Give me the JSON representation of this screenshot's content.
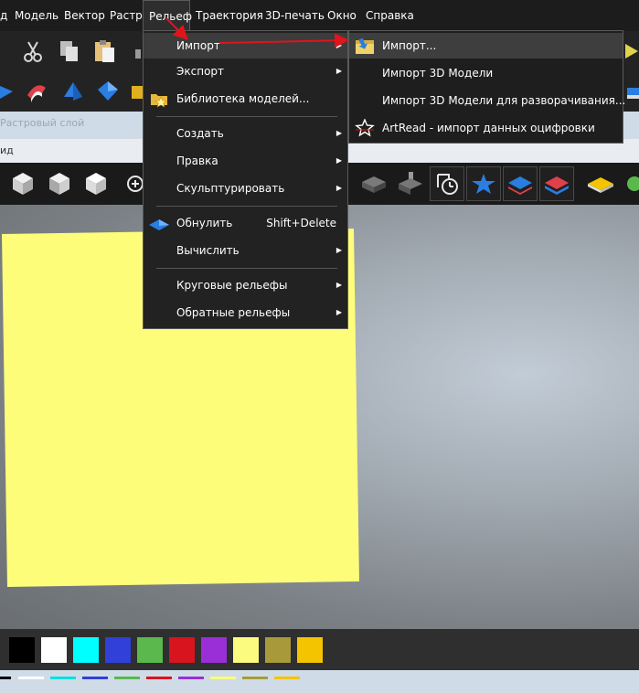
{
  "menubar": {
    "items": [
      {
        "label": "д"
      },
      {
        "label": "Модель"
      },
      {
        "label": "Вектор"
      },
      {
        "label": "Растр"
      },
      {
        "label": "Рельеф"
      },
      {
        "label": "Траектория"
      },
      {
        "label": "3D-печать"
      },
      {
        "label": "Окно"
      },
      {
        "label": "Справка"
      }
    ]
  },
  "panels": {
    "raster_layer": "Растровый слой",
    "view_fragment": "ид"
  },
  "relief_menu": {
    "items": [
      {
        "label": "Импорт",
        "has_submenu": true
      },
      {
        "label": "Экспорт",
        "has_submenu": true
      },
      {
        "label": "Библиотека моделей...",
        "icon": "folder-star-icon"
      },
      {
        "label": "Создать",
        "has_submenu": true
      },
      {
        "label": "Правка",
        "has_submenu": true
      },
      {
        "label": "Скульптурировать",
        "has_submenu": true
      },
      {
        "label": "Обнулить",
        "shortcut": "Shift+Delete",
        "icon": "zero-relief-icon"
      },
      {
        "label": "Вычислить",
        "has_submenu": true
      },
      {
        "label": "Круговые рельефы",
        "has_submenu": true
      },
      {
        "label": "Обратные рельефы",
        "has_submenu": true
      }
    ]
  },
  "import_submenu": {
    "items": [
      {
        "label": "Импорт...",
        "icon": "import-icon"
      },
      {
        "label": "Импорт 3D Модели"
      },
      {
        "label": "Импорт 3D Модели для разворачивания..."
      },
      {
        "label": "ArtRead - импорт данных оцифровки",
        "icon": "artread-star-icon"
      }
    ]
  },
  "colors": {
    "accent_arrow": "#e0141b",
    "relief_preview": "#fdfd7a",
    "palette": [
      "#000000",
      "#ffffff",
      "#00ffff",
      "#3040d8",
      "#5ab84c",
      "#d8141e",
      "#9a2fd8",
      "#fbfb80",
      "#a89a3a",
      "#f5c400"
    ]
  }
}
